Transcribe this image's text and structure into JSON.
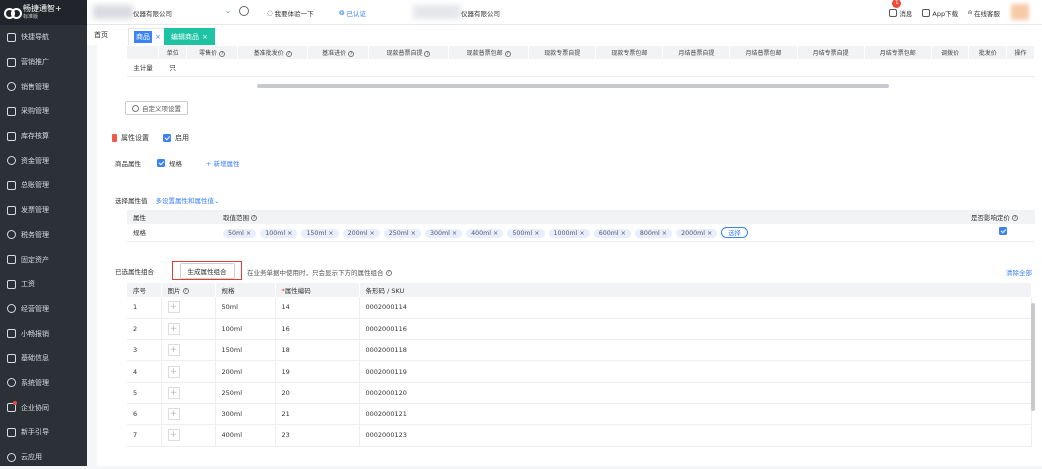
{
  "sidebar": {
    "logo_text": "畅捷通智+",
    "logo_sub": "标准版",
    "items": [
      {
        "label": "快捷导航",
        "icon": "home-icon"
      },
      {
        "label": "营销推广",
        "icon": "marketing-icon"
      },
      {
        "label": "销售管理",
        "icon": "sales-icon"
      },
      {
        "label": "采购管理",
        "icon": "purchase-icon"
      },
      {
        "label": "库存核算",
        "icon": "inventory-icon"
      },
      {
        "label": "资金管理",
        "icon": "fund-icon"
      },
      {
        "label": "总账管理",
        "icon": "ledger-icon"
      },
      {
        "label": "发票管理",
        "icon": "invoice-icon"
      },
      {
        "label": "税务管理",
        "icon": "tax-icon"
      },
      {
        "label": "固定资产",
        "icon": "asset-icon"
      },
      {
        "label": "工资",
        "icon": "salary-icon"
      },
      {
        "label": "经营管理",
        "icon": "business-icon"
      },
      {
        "label": "小畅报销",
        "icon": "reimburse-icon"
      },
      {
        "label": "基础信息",
        "icon": "basic-info-icon"
      },
      {
        "label": "系统管理",
        "icon": "system-icon"
      },
      {
        "label": "企业协同",
        "icon": "collab-icon"
      },
      {
        "label": "新手引导",
        "icon": "guide-icon"
      },
      {
        "label": "云应用",
        "icon": "cloud-icon"
      }
    ]
  },
  "topbar": {
    "company": "仪器有限公司",
    "feedback": "我要体验一下",
    "tag": "已认证",
    "company2": "仪器有限公司",
    "message": "消息",
    "message_badge": "1",
    "app_download": "App下载",
    "online_service": "在线客服"
  },
  "tabs": {
    "home": "首页",
    "tab1": "商品",
    "tab2": "编辑商品"
  },
  "price_table": {
    "headers": [
      "",
      "单位",
      "零售价",
      "基准批发价",
      "基准进价",
      "现款普票自提",
      "现款普票包邮",
      "现款专票自提",
      "现款专票包邮",
      "月结普票自提",
      "月结普票包邮",
      "月结专票自提",
      "月结专票包邮",
      "调拨价",
      "批发价",
      "操作"
    ],
    "row": [
      "主计量",
      "只"
    ]
  },
  "custom_settings": "自定义项设置",
  "attr_settings": {
    "title": "属性设置",
    "enable": "启用",
    "label": "商品属性",
    "spec": "规格",
    "add_attr": "+ 新增属性"
  },
  "select_values": {
    "label": "选择属性值",
    "multi_link": "多设置属性和属性值"
  },
  "attr_table": {
    "headers": [
      "属性",
      "取值范围",
      "是否影响定价"
    ],
    "row_name": "规格",
    "chips": [
      "50ml ×",
      "100ml ×",
      "150ml ×",
      "200ml ×",
      "250ml ×",
      "300ml ×",
      "400ml ×",
      "500ml ×",
      "1000ml ×",
      "600ml ×",
      "800ml ×",
      "2000ml ×"
    ],
    "select": "选择"
  },
  "combo": {
    "label": "已选属性组合",
    "generate": "生成属性组合",
    "hint": "在业务单据中使用时，只会显示下方的属性组合",
    "clear_all": "清除全部"
  },
  "sku_table": {
    "headers": [
      "序号",
      "图片",
      "规格",
      "属性编码",
      "条形码 / SKU"
    ],
    "rows": [
      {
        "no": "1",
        "spec": "50ml",
        "code": "14",
        "sku": "0002000114"
      },
      {
        "no": "2",
        "spec": "100ml",
        "code": "16",
        "sku": "0002000116"
      },
      {
        "no": "3",
        "spec": "150ml",
        "code": "18",
        "sku": "0002000118"
      },
      {
        "no": "4",
        "spec": "200ml",
        "code": "19",
        "sku": "0002000119"
      },
      {
        "no": "5",
        "spec": "250ml",
        "code": "20",
        "sku": "0002000120"
      },
      {
        "no": "6",
        "spec": "300ml",
        "code": "21",
        "sku": "0002000121"
      },
      {
        "no": "7",
        "spec": "400ml",
        "code": "23",
        "sku": "0002000123"
      }
    ]
  },
  "colors": {
    "sidebar_bg": "#2c3138",
    "accent": "#3b82f6",
    "tab_green": "#1ec3a4",
    "highlight_red": "#e53935"
  }
}
